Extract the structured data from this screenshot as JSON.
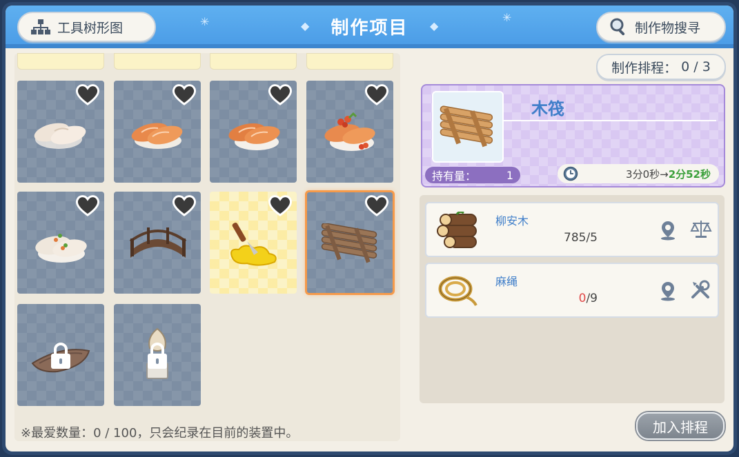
{
  "header": {
    "title": "制作项目",
    "tool_tree_label": "工具树形图",
    "search_label": "制作物搜寻"
  },
  "queue": {
    "label": "制作排程：",
    "value": "0 / 3"
  },
  "grid": {
    "items": [
      {
        "name": "white-fish-sushi-icon",
        "favorite": false,
        "locked": false,
        "style": "normal"
      },
      {
        "name": "salmon-sushi-icon",
        "favorite": false,
        "locked": false,
        "style": "normal"
      },
      {
        "name": "salmon-sushi-icon",
        "favorite": false,
        "locked": false,
        "style": "normal"
      },
      {
        "name": "roe-sushi-icon",
        "favorite": false,
        "locked": false,
        "style": "normal"
      },
      {
        "name": "herb-sushi-icon",
        "favorite": false,
        "locked": false,
        "style": "normal"
      },
      {
        "name": "wooden-bridge-icon",
        "favorite": false,
        "locked": false,
        "style": "normal"
      },
      {
        "name": "butter-knife-icon",
        "favorite": false,
        "locked": false,
        "style": "gold"
      },
      {
        "name": "wooden-raft-icon",
        "favorite": false,
        "locked": false,
        "style": "selected"
      },
      {
        "name": "boat-icon",
        "favorite": false,
        "locked": true,
        "style": "normal"
      },
      {
        "name": "lamp-icon",
        "favorite": false,
        "locked": true,
        "style": "normal"
      }
    ],
    "footer_note": "※最爱数量：0 / 100，只会纪录在目前的装置中。"
  },
  "selected_item": {
    "name": "木筏",
    "owned_label": "持有量：",
    "owned_value": "1",
    "time_old": "3分0秒→",
    "time_new": "2分52秒"
  },
  "materials": [
    {
      "name": "柳安木",
      "have": "785",
      "need": "/5",
      "icon": "logs-icon",
      "action_icon": "scale-icon"
    },
    {
      "name": "麻绳",
      "have": "0",
      "need": "/9",
      "icon": "rope-icon",
      "action_icon": "tools-icon"
    }
  ],
  "add_button_label": "加入排程",
  "colors": {
    "header_blue": "#4a9be6",
    "selected_outline": "#f59a4a",
    "card_purple": "#d9c8f2",
    "accent_text_blue": "#3f7ec9",
    "time_green": "#3ba03b",
    "warning_red": "#e04848"
  }
}
